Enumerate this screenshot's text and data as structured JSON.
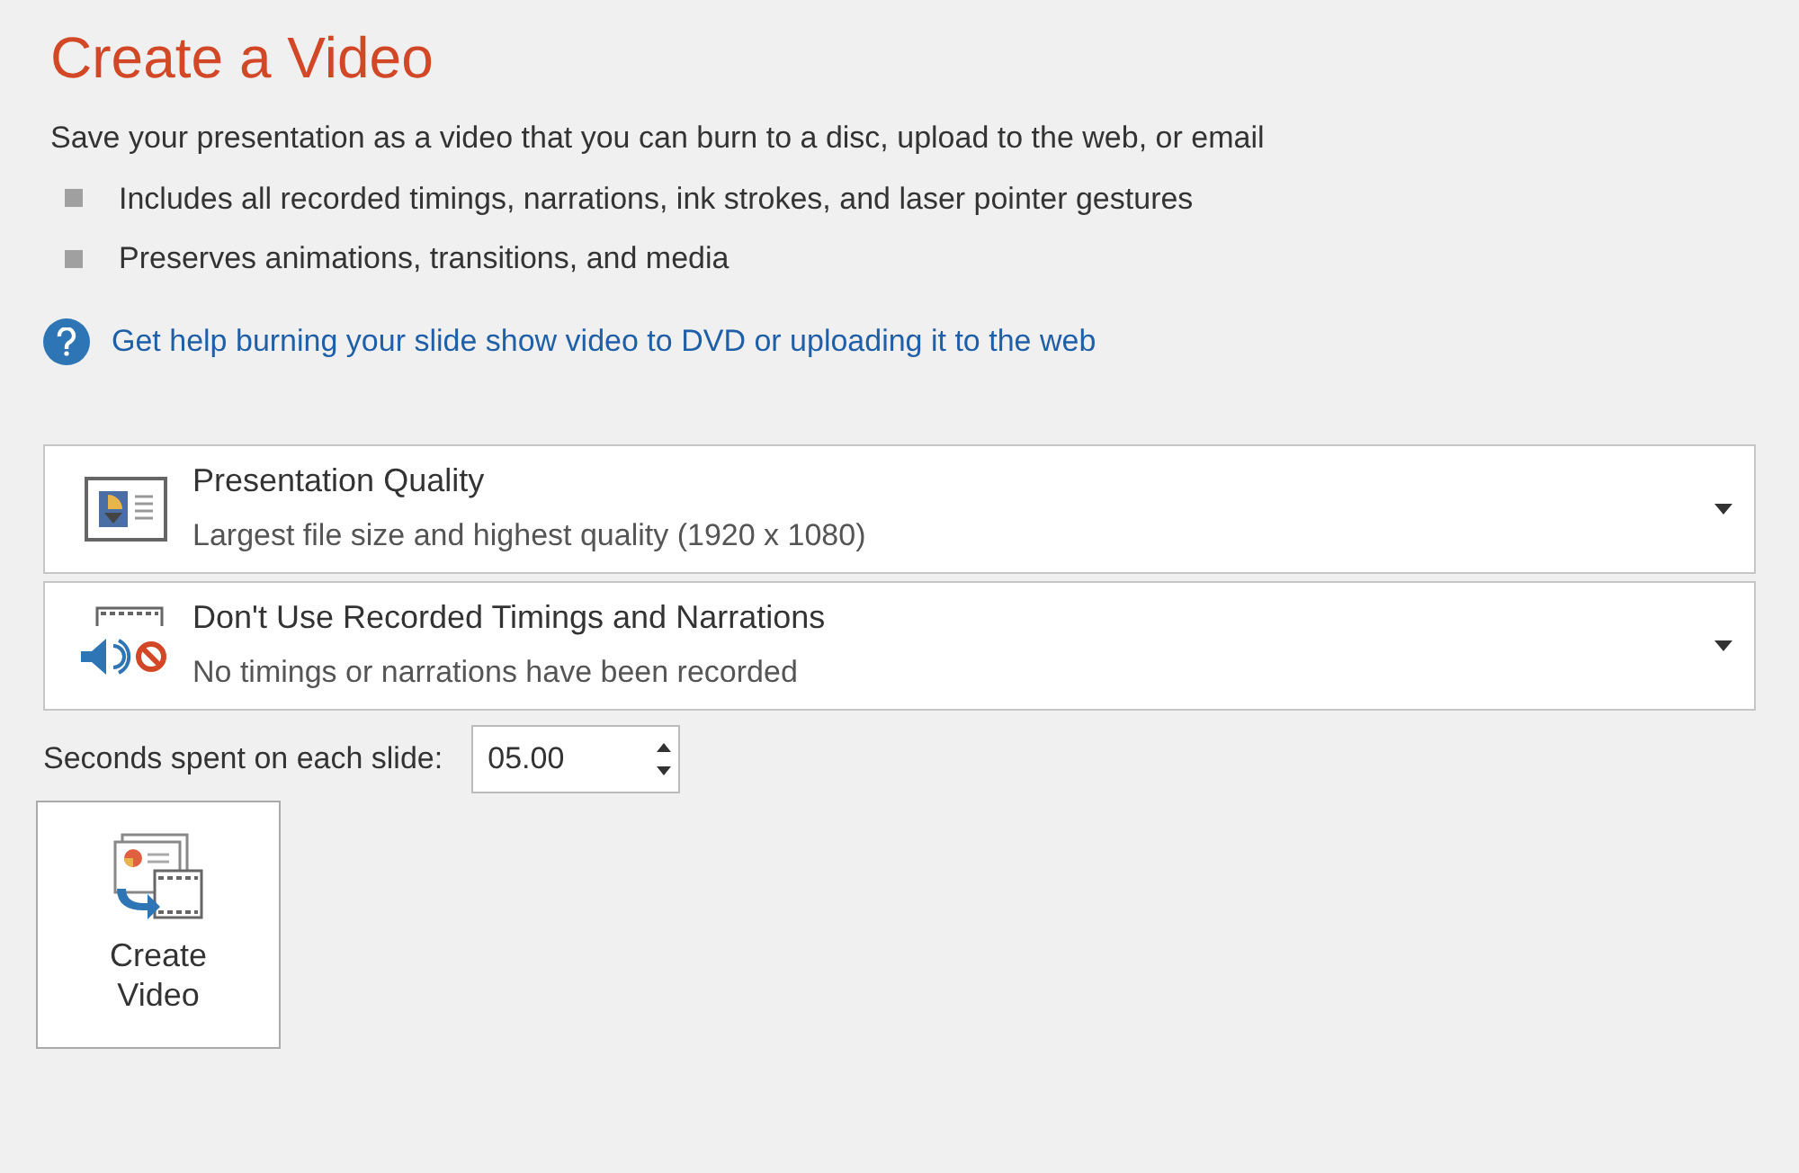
{
  "title": "Create a Video",
  "description": "Save your presentation as a video that you can burn to a disc, upload to the web, or email",
  "bullets": [
    "Includes all recorded timings, narrations, ink strokes, and laser pointer gestures",
    "Preserves animations, transitions, and media"
  ],
  "help_link": "Get help burning your slide show video to DVD or uploading it to the web",
  "dropdowns": [
    {
      "kind": "quality",
      "title": "Presentation Quality",
      "subtitle": "Largest file size and highest quality (1920 x 1080)"
    },
    {
      "kind": "timings",
      "title": "Don't Use Recorded Timings and Narrations",
      "subtitle": "No timings or narrations have been recorded"
    }
  ],
  "seconds": {
    "label": "Seconds spent on each slide:",
    "value": "05.00"
  },
  "create_button": {
    "line_1": "Create",
    "line_2": "Video"
  }
}
